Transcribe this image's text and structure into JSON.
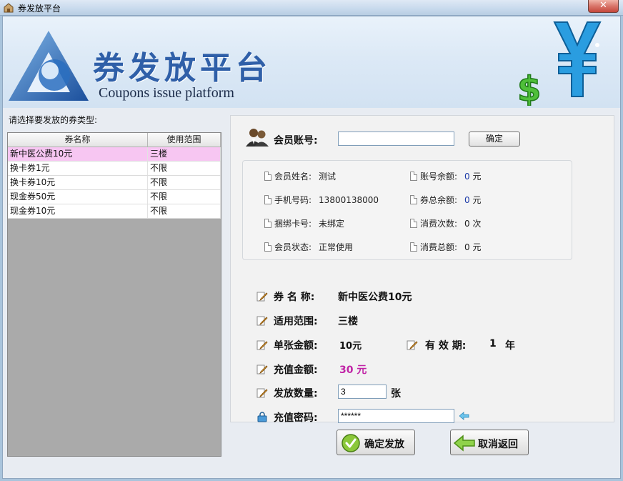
{
  "window": {
    "title": "券发放平台",
    "close_glyph": "✕"
  },
  "banner": {
    "title_cn": "券发放平台",
    "title_en": "Coupons issue platform"
  },
  "coupon_list": {
    "prompt": "请选择要发放的券类型:",
    "columns": [
      "券名称",
      "使用范围"
    ],
    "rows": [
      {
        "name": "新中医公费10元",
        "scope": "三楼",
        "selected": true
      },
      {
        "name": "换卡券1元",
        "scope": "不限"
      },
      {
        "name": "换卡券10元",
        "scope": "不限"
      },
      {
        "name": "现金券50元",
        "scope": "不限"
      },
      {
        "name": "现金券10元",
        "scope": "不限"
      }
    ]
  },
  "member": {
    "account_label": "会员账号:",
    "account_value": "",
    "confirm_label": "确定",
    "info": {
      "name_label": "会员姓名:",
      "name_value": "测试",
      "phone_label": "手机号码:",
      "phone_value": "13800138000",
      "card_label": "捆绑卡号:",
      "card_value": "未绑定",
      "status_label": "会员状态:",
      "status_value": "正常使用",
      "balance_label": "账号余额:",
      "balance_value": "0",
      "balance_unit": "元",
      "coupon_balance_label": "券总余额:",
      "coupon_balance_value": "0",
      "coupon_balance_unit": "元",
      "count_label": "消费次数:",
      "count_value": "0",
      "count_unit": "次",
      "total_label": "消费总额:",
      "total_value": "0",
      "total_unit": "元"
    }
  },
  "coupon_detail": {
    "name_label": "券 名 称:",
    "name_value": "新中医公费10元",
    "scope_label": "适用范围:",
    "scope_value": "三楼",
    "amount_label": "单张金额:",
    "amount_value": "10元",
    "validity_label": "有 效 期:",
    "validity_value": "1",
    "validity_unit": "年",
    "recharge_label": "充值金额:",
    "recharge_value": "30 元",
    "qty_label": "发放数量:",
    "qty_value": "3",
    "qty_unit": "张",
    "pwd_label": "充值密码:",
    "pwd_value": "******"
  },
  "actions": {
    "issue_label": "确定发放",
    "cancel_label": "取消返回"
  },
  "colors": {
    "selected_row": "#f7c6f2",
    "accent_blue": "#2f5fa8",
    "magenta": "#c023a6",
    "info_blue": "#1c3aa8"
  }
}
